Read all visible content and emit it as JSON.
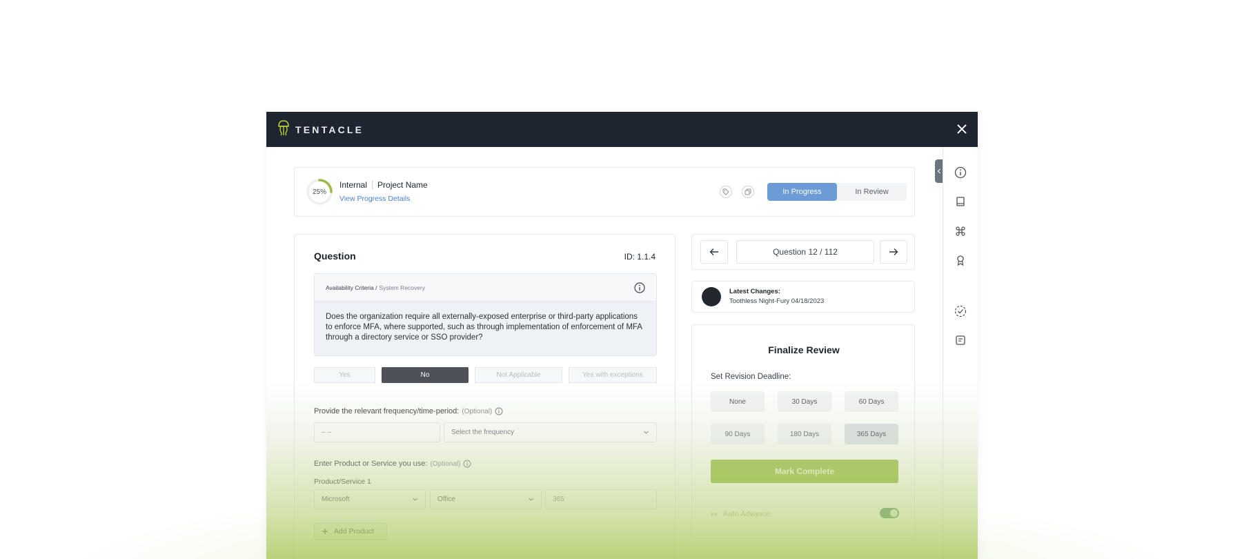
{
  "app": {
    "brand": "TENTACLE",
    "brand_icon": "jellyfish-logo-icon",
    "accent_color": "#9abc46",
    "header_color": "#1f2530"
  },
  "project": {
    "progress_label": "25%",
    "progress_value": 0.25,
    "type": "Internal",
    "name": "Project Name",
    "view_link": "View Progress Details",
    "status_options": [
      "In Progress",
      "In Review"
    ],
    "status_selected": "In Progress"
  },
  "question": {
    "heading": "Question",
    "id_label": "ID: 1.1.4",
    "category": "Availability Criteria /",
    "subcategory": "System Recovery",
    "text": "Does the organization require all externally-exposed enterprise or third-party applications to enforce MFA, where supported, such as through implementation of enforcement of MFA through a directory service or SSO provider?",
    "answers": [
      "Yes",
      "No",
      "Not Applicable",
      "Yes with exceptions"
    ],
    "selected_answer": "No"
  },
  "frequency": {
    "label": "Provide the relevant frequency/time-period:",
    "optional": "(Optional)",
    "period_placeholder": "– –",
    "select_placeholder": "Select the frequency"
  },
  "products": {
    "label": "Enter Product or Service you use:",
    "optional": "(Optional)",
    "item_label": "Product/Service 1",
    "vendor": "Microsoft",
    "product": "Office",
    "version": "365",
    "add_label": "Add Product"
  },
  "navigation": {
    "counter": "Question 12 / 112"
  },
  "changes": {
    "title": "Latest Changes:",
    "detail": "Toothless Night-Fury 04/18/2023"
  },
  "finalize": {
    "title": "Finalize Review",
    "deadline_label": "Set Revision Deadline:",
    "options": [
      "None",
      "30 Days",
      "60 Days",
      "90 Days",
      "180 Days",
      "365 Days"
    ],
    "selected": "365 Days",
    "mark_complete": "Mark Complete",
    "auto_advance": "Auto Advance",
    "auto_advance_on": true
  },
  "rail_icons": [
    "info-icon",
    "book-icon",
    "command-icon",
    "award-icon",
    "check-circle-icon",
    "notes-icon"
  ]
}
